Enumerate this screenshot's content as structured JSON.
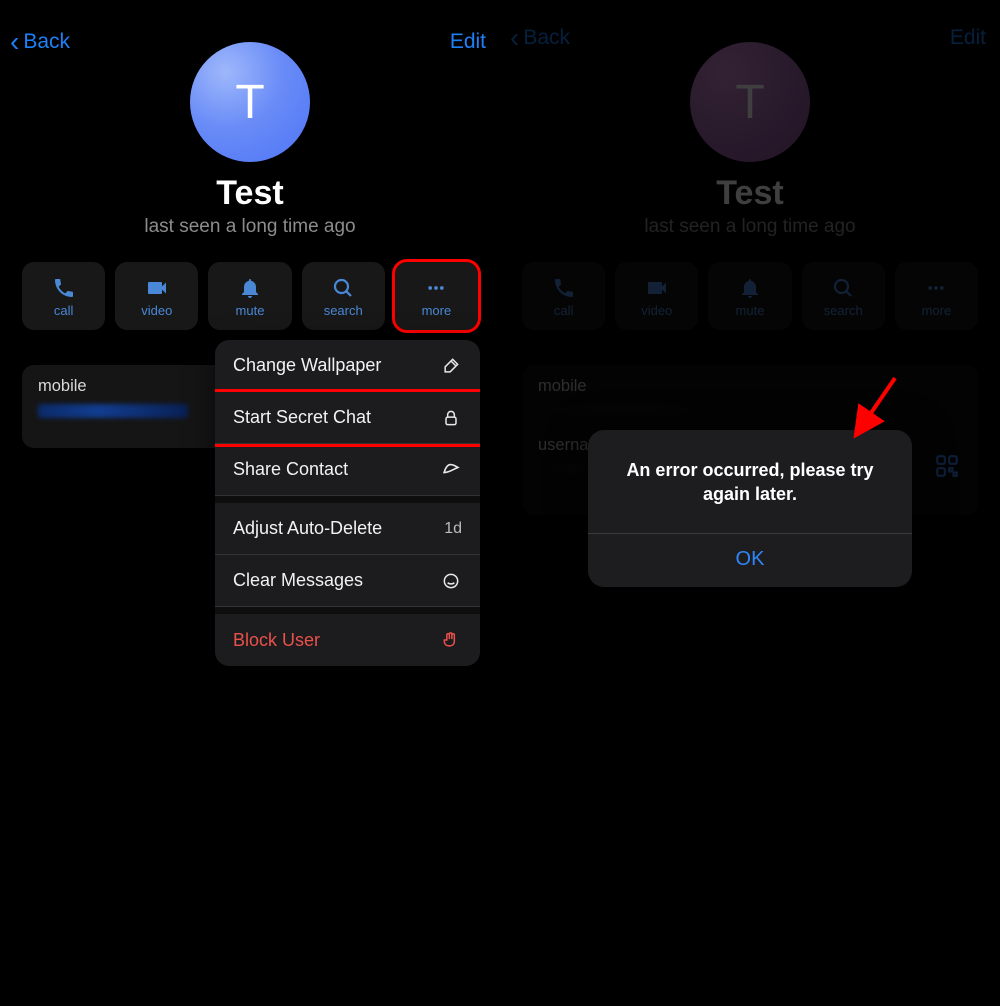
{
  "nav": {
    "back": "Back",
    "edit": "Edit"
  },
  "profile": {
    "initial": "T",
    "name": "Test",
    "status": "last seen a long time ago"
  },
  "actions": {
    "call": "call",
    "video": "video",
    "mute": "mute",
    "search": "search",
    "more": "more"
  },
  "info": {
    "mobile_label": "mobile",
    "username_label": "userna"
  },
  "menu": {
    "change_wallpaper": "Change Wallpaper",
    "start_secret_chat": "Start Secret Chat",
    "share_contact": "Share Contact",
    "adjust_auto_delete": "Adjust Auto-Delete",
    "auto_delete_value": "1d",
    "clear_messages": "Clear Messages",
    "block_user": "Block User"
  },
  "alert": {
    "message": "An error occurred, please try again later.",
    "ok": "OK"
  }
}
